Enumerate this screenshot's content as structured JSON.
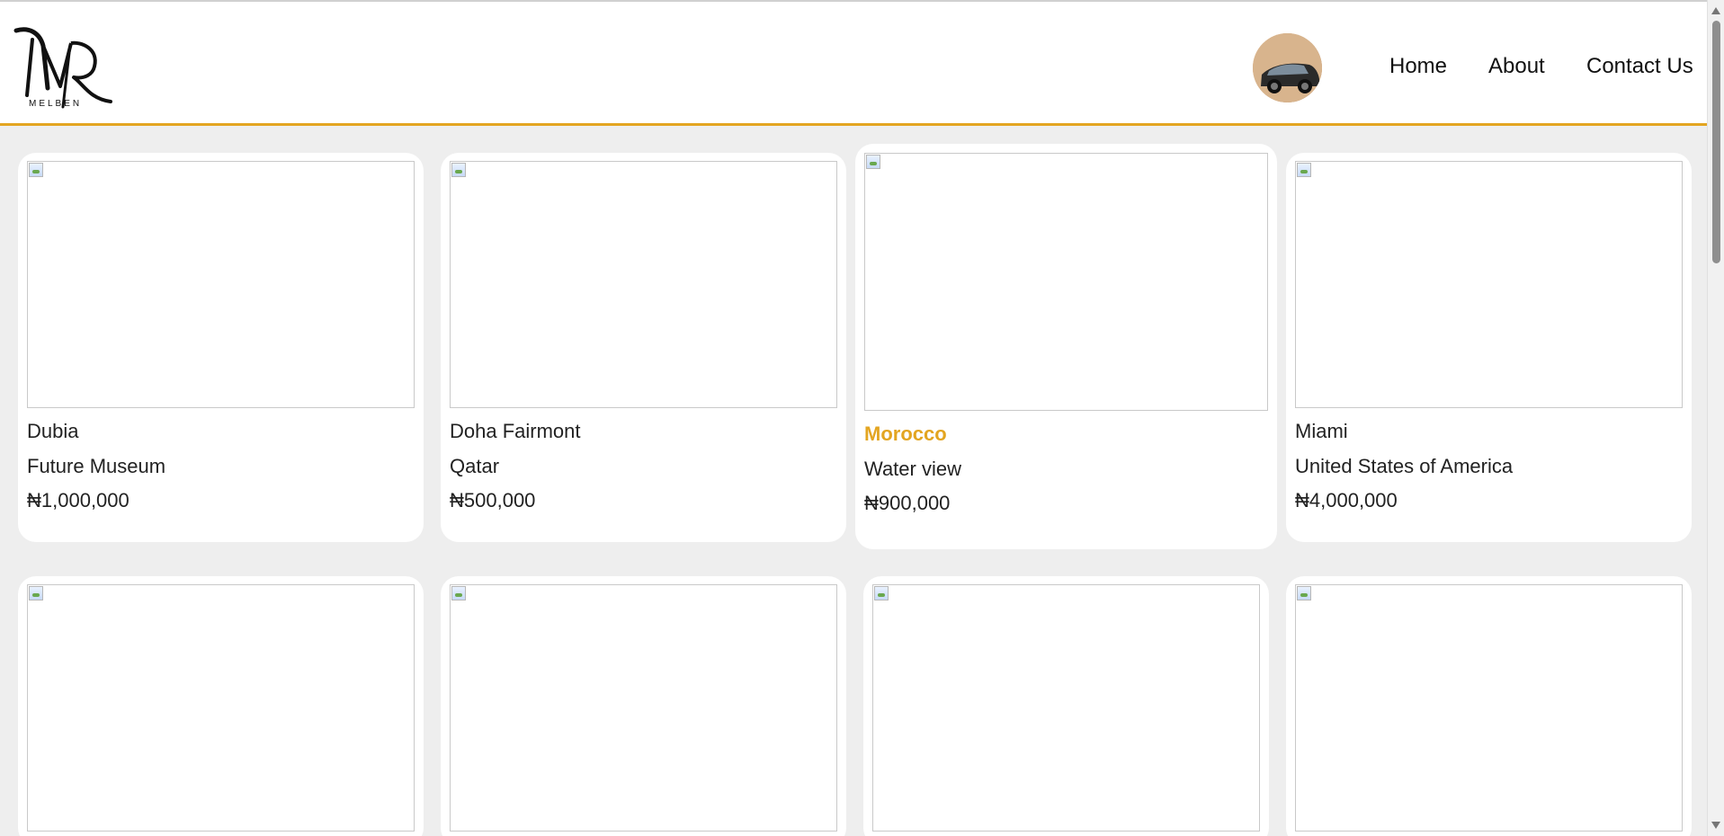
{
  "header": {
    "logo": {
      "mark": "MR",
      "brand": "MELBEN"
    },
    "avatar_icon": "car-avatar-icon",
    "nav": [
      "Home",
      "About",
      "Contact Us"
    ]
  },
  "cards": [
    {
      "title": "Dubia",
      "subtitle": "Future Museum",
      "price": "₦1,000,000",
      "active": false
    },
    {
      "title": "Doha Fairmont",
      "subtitle": "Qatar",
      "price": "₦500,000",
      "active": false
    },
    {
      "title": "Morocco",
      "subtitle": "Water view",
      "price": "₦900,000",
      "active": true
    },
    {
      "title": "Miami",
      "subtitle": "United States of America",
      "price": "₦4,000,000",
      "active": false
    },
    {
      "title": "",
      "subtitle": "",
      "price": "",
      "active": false
    },
    {
      "title": "",
      "subtitle": "",
      "price": "",
      "active": false
    },
    {
      "title": "",
      "subtitle": "",
      "price": "",
      "active": false
    },
    {
      "title": "",
      "subtitle": "",
      "price": "",
      "active": false
    }
  ],
  "colors": {
    "accent": "#e3a521",
    "page_bg": "#eeeeee",
    "card_bg": "#ffffff"
  }
}
